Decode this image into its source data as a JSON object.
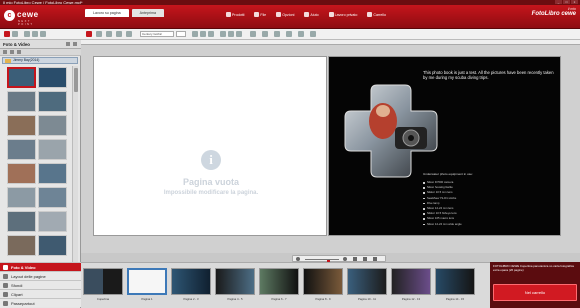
{
  "window": {
    "title": "Il mio FotoLibro Cewe / FotoLibro Cewe.mcf*"
  },
  "header": {
    "logo_text": "cewe",
    "logo_mark": "c",
    "logo_tag": "NEXT POINT",
    "tabs": [
      {
        "label": "Lavoro su pagina"
      },
      {
        "label": "Anteprima"
      }
    ],
    "menu": [
      {
        "label": "Prodotti",
        "icon": "box-icon"
      },
      {
        "label": "File",
        "icon": "file-icon"
      },
      {
        "label": "Opzioni",
        "icon": "options-icon"
      },
      {
        "label": "Aiuto",
        "icon": "help-icon"
      },
      {
        "label": "Lavoro privato",
        "icon": "lock-icon"
      },
      {
        "label": "Carrello",
        "icon": "cart-icon"
      }
    ],
    "brand_script": "il mio",
    "brand_main": "FotoLibro cewe",
    "accent": "#c5151c"
  },
  "toolbar": {
    "font": "Century Gothic"
  },
  "sidebar": {
    "title": "Foto & Video",
    "folder": "Jimmy Bay(2014)",
    "accordion": [
      {
        "label": "Foto & Video",
        "active": true
      },
      {
        "label": "Layout delle pagine",
        "active": false
      },
      {
        "label": "Sfondi",
        "active": false
      },
      {
        "label": "Clipart",
        "active": false
      },
      {
        "label": "Passepartout",
        "active": false
      }
    ]
  },
  "canvas": {
    "empty_title": "Pagina vuota",
    "empty_sub": "Impossibile modificare la pagina.",
    "info_glyph": "i",
    "photo_text": "This photo book is just a test. All the pictures have been recently taken by me during my scuba diving trips.",
    "equip_head": "Underwater photo equipment in use:",
    "equipment": [
      "Nikon D7000 camera",
      "Nikon housing Ikelite",
      "Nikkor 10.5 mm lens",
      "Sea&Sea YS-D1 strobe",
      "Dive lamp",
      "Nikon 12-24 mm lens",
      "Nikkor 10.5 fisheye lens",
      "Nikon 105 macro lens",
      "Nikon 12-24 mm wide angle"
    ]
  },
  "pages": [
    {
      "label": "Copertina"
    },
    {
      "label": "Pagina 1"
    },
    {
      "label": "Pagina 2 - 3"
    },
    {
      "label": "Pagina 4 - 5"
    },
    {
      "label": "Pagina 6 - 7"
    },
    {
      "label": "Pagina 8 - 9"
    },
    {
      "label": "Pagina 10 - 11"
    },
    {
      "label": "Pagina 12 - 13"
    },
    {
      "label": "Pagina 14 - 15"
    }
  ],
  "cart": {
    "promo": "FOTOLIBRO CEWE Copertina panoramica no carta fotografica extra opaca (26 pagine)",
    "button": "Nel carrello"
  }
}
